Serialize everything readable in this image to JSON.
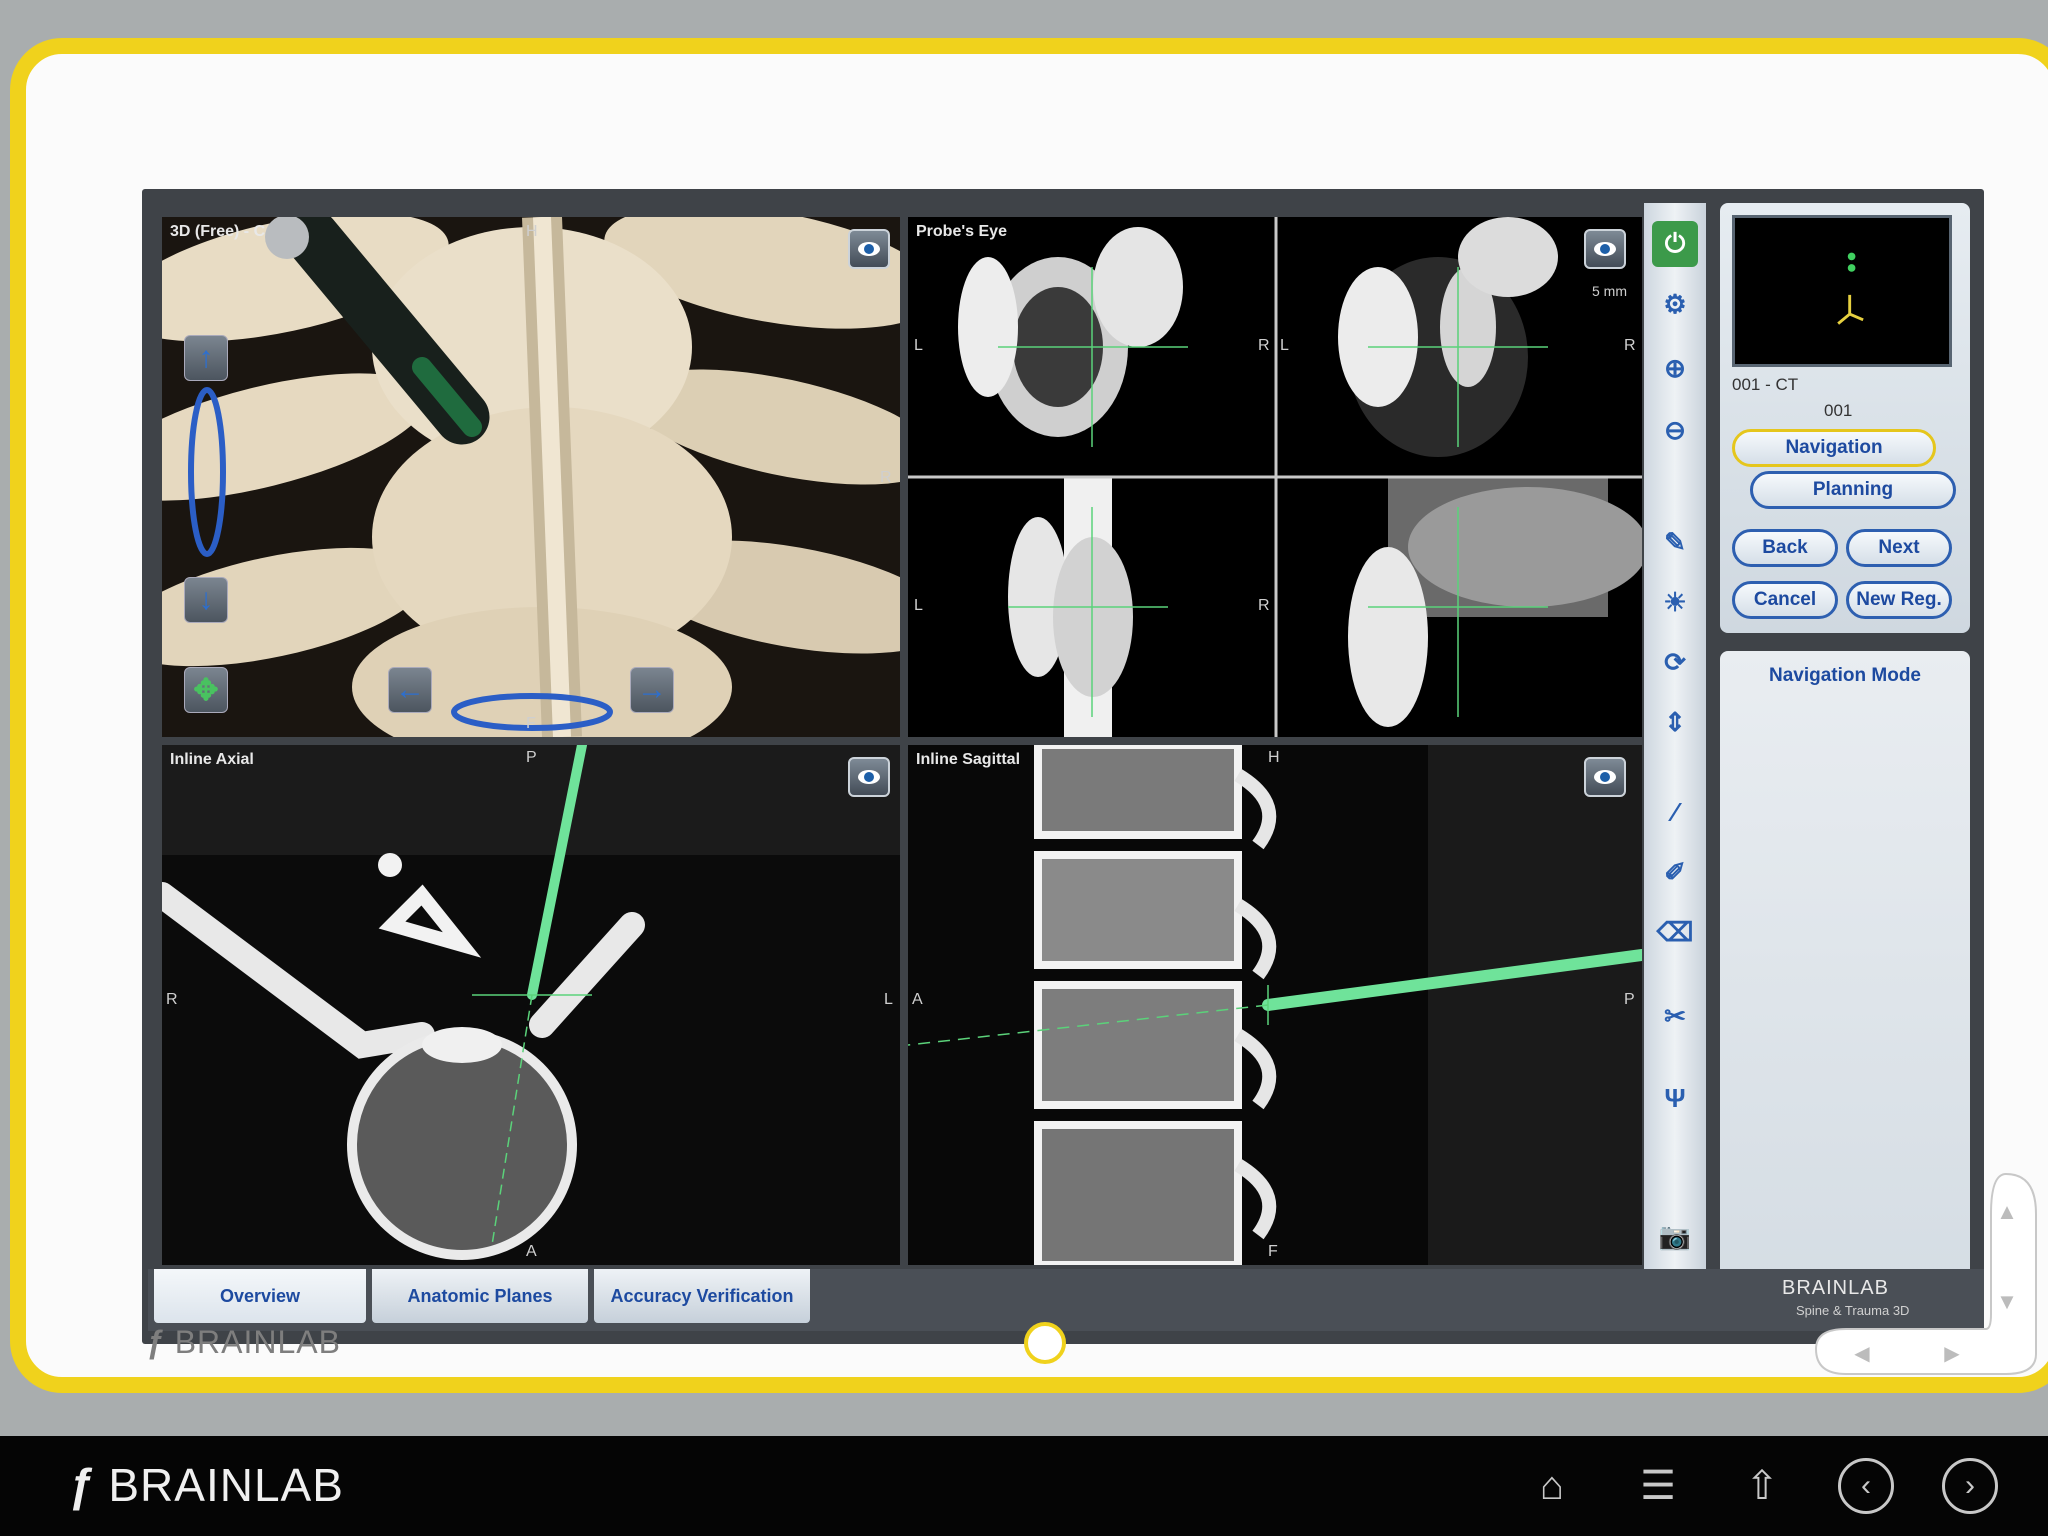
{
  "views": {
    "top_left_label": "3D (Free) - C",
    "top_right_label": "Probe's Eye",
    "bottom_left_label": "Inline Axial",
    "bottom_right_label": "Inline Sagittal",
    "slice_distance": "5 mm"
  },
  "orient": {
    "r": "R",
    "l": "L",
    "a": "A",
    "p": "P",
    "f": "F",
    "h": "H"
  },
  "series": {
    "name": "001 - CT",
    "id": "001"
  },
  "buttons": {
    "navigation": "Navigation",
    "planning": "Planning",
    "back": "Back",
    "next": "Next",
    "cancel": "Cancel",
    "new_reg": "New Reg."
  },
  "mode_title": "Navigation Mode",
  "tabs": [
    {
      "label": "Overview"
    },
    {
      "label": "Anatomic Planes"
    },
    {
      "label": "Accuracy Verification"
    }
  ],
  "branding": {
    "brand": "BRAINLAB",
    "product": "Spine & Trauma 3D"
  },
  "colors": {
    "frame": "#f0d21c",
    "accent_blue": "#1d4aa0",
    "probe_green": "#6fe39a"
  }
}
